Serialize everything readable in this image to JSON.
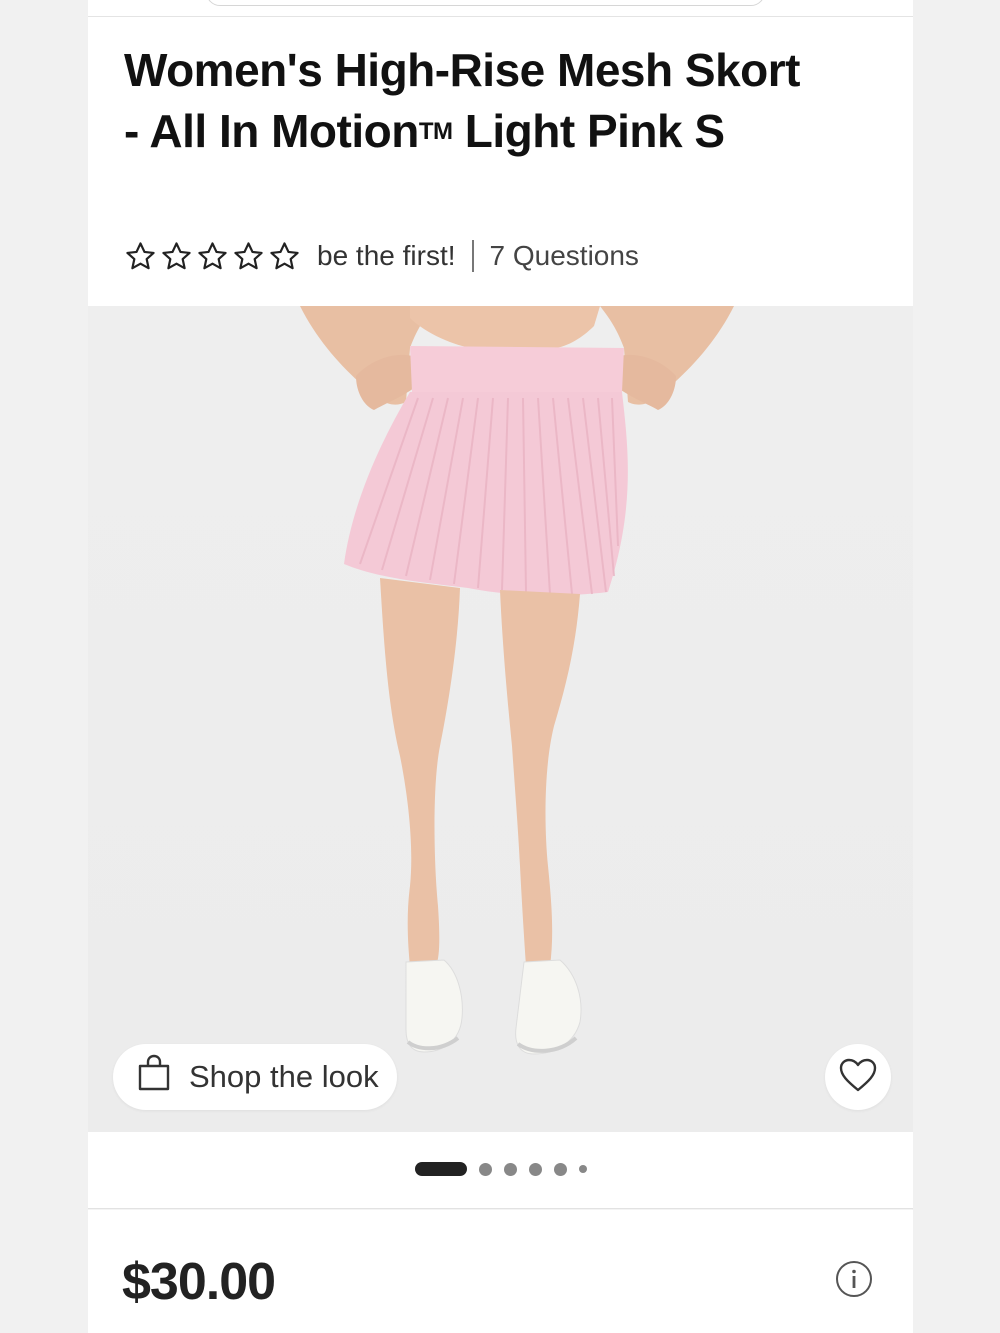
{
  "product": {
    "title_main": "Women's High-Rise Mesh Skort - All In Motion",
    "title_tm": "TM",
    "title_tail": " Light Pink S",
    "rating_stars": 0,
    "rating_max": 5,
    "rating_prompt": "be the first!",
    "questions": "7 Questions",
    "price": "$30.00"
  },
  "image": {
    "shop_the_look": "Shop the look",
    "carousel_total": 6,
    "carousel_active": 1
  },
  "colors": {
    "skirt": "#f4c9d6",
    "text": "#111111",
    "carousel_active": "#222222",
    "carousel_inactive": "#888888"
  },
  "icons": [
    "star-outline-icon",
    "shopping-bag-icon",
    "heart-icon",
    "info-icon"
  ]
}
